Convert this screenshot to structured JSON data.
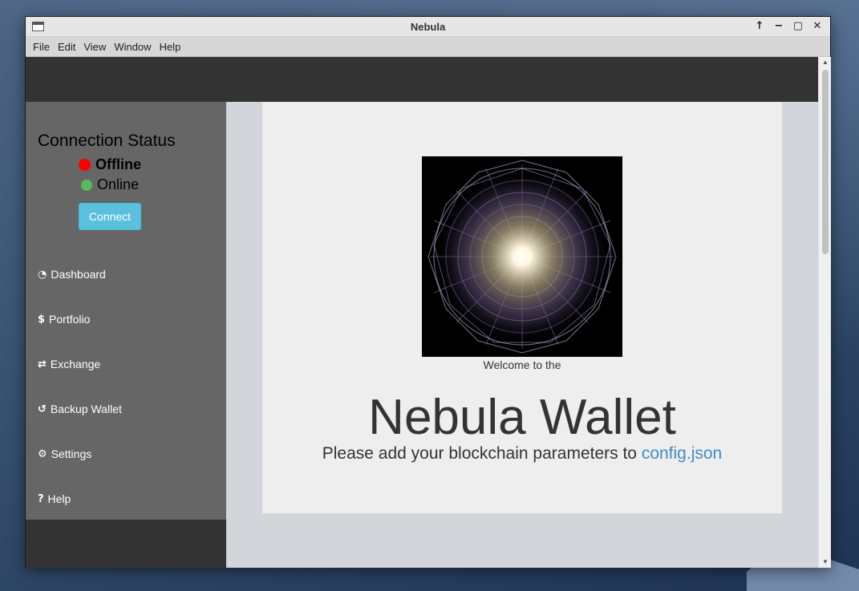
{
  "window": {
    "title": "Nebula",
    "controls": [
      "↑",
      "−",
      "▢",
      "✕"
    ]
  },
  "menubar": {
    "items": [
      "File",
      "Edit",
      "View",
      "Window",
      "Help"
    ]
  },
  "sidebar": {
    "connection_title": "Connection Status",
    "status_offline": "Offline",
    "status_online": "Online",
    "connect_label": "Connect",
    "nav": [
      {
        "label": "Dashboard",
        "icon": "dashboard-icon",
        "glyph": "◔"
      },
      {
        "label": "Portfolio",
        "icon": "dollar-icon",
        "glyph": "$"
      },
      {
        "label": "Exchange",
        "icon": "exchange-icon",
        "glyph": "⇄"
      },
      {
        "label": "Backup Wallet",
        "icon": "undo-icon",
        "glyph": "↺"
      },
      {
        "label": "Settings",
        "icon": "gears-icon",
        "glyph": "⚙"
      },
      {
        "label": "Help",
        "icon": "question-icon",
        "glyph": "?"
      }
    ]
  },
  "main": {
    "welcome": "Welcome to the",
    "hero_title": "Nebula Wallet",
    "subtitle_prefix": "Please add your blockchain parameters to",
    "subtitle_link": "config.json"
  },
  "colors": {
    "offline": "#ff0000",
    "online": "#5cb85c",
    "connect_button": "#5bc0de",
    "link": "#428bca",
    "sidebar": "#666666",
    "topbar": "#333333"
  }
}
